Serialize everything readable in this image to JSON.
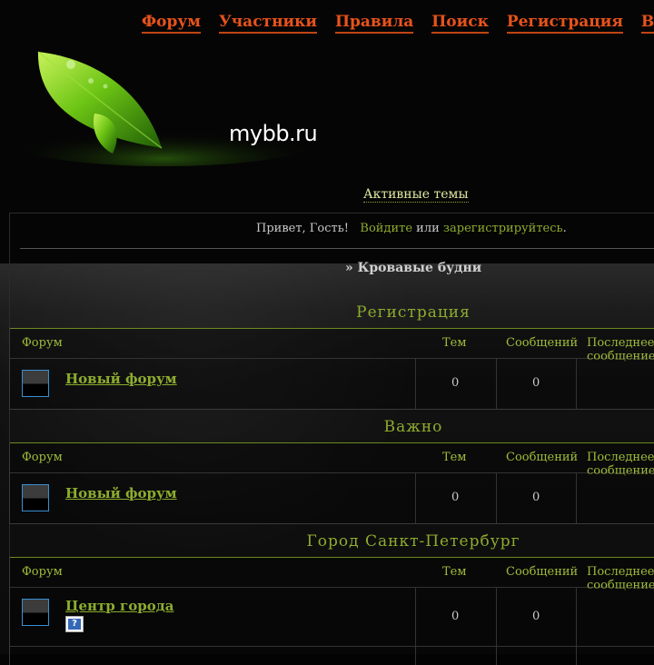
{
  "nav": {
    "items": [
      "Форум",
      "Участники",
      "Правила",
      "Поиск",
      "Регистрация",
      "Вход"
    ]
  },
  "logo": {
    "text": "mybb.ru"
  },
  "active_topics": "Активные темы",
  "welcome": {
    "greeting": "Привет, Гость!",
    "login": "Войдите",
    "or": "или",
    "register": "зарегистрируйтесь",
    "end": "."
  },
  "breadcrumb": "» Кровавые будни",
  "columns": {
    "forum": "Форум",
    "topics": "Тем",
    "posts": "Сообщений",
    "last": "Последнее сообщение"
  },
  "categories": [
    {
      "title": "Регистрация",
      "forums": [
        {
          "name": "Новый форум",
          "topics": "0",
          "posts": "0"
        }
      ]
    },
    {
      "title": "Важно",
      "forums": [
        {
          "name": "Новый форум",
          "topics": "0",
          "posts": "0"
        }
      ]
    },
    {
      "title": "Город Санкт-Петербург",
      "forums": [
        {
          "name": "Центр города",
          "topics": "0",
          "posts": "0",
          "subicon": "?"
        }
      ]
    }
  ],
  "colors": {
    "accent": "#8dac2e",
    "nav": "#e8531b"
  }
}
